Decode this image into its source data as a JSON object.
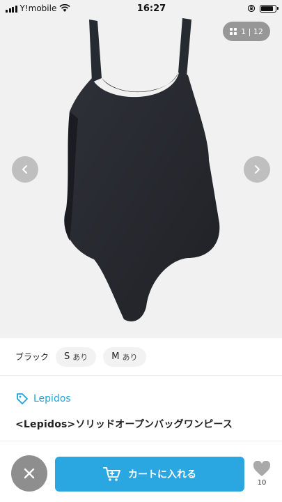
{
  "status_bar": {
    "carrier": "Y!mobile",
    "time": "16:27",
    "battery_level": 0.9
  },
  "gallery": {
    "counter": "1 | 12",
    "prev_icon": "chevron-left-icon",
    "next_icon": "chevron-right-icon"
  },
  "variants": {
    "color": "ブラック",
    "sizes": [
      {
        "size": "S",
        "stock": "あり"
      },
      {
        "size": "M",
        "stock": "あり"
      }
    ]
  },
  "product": {
    "brand": "Lepidos",
    "title": "<Lepidos>ソリッドオープンバッグワンピース"
  },
  "bottom_bar": {
    "cart_label": "カートに入れる",
    "like_count": "10",
    "accent_color": "#2aa7e0"
  }
}
